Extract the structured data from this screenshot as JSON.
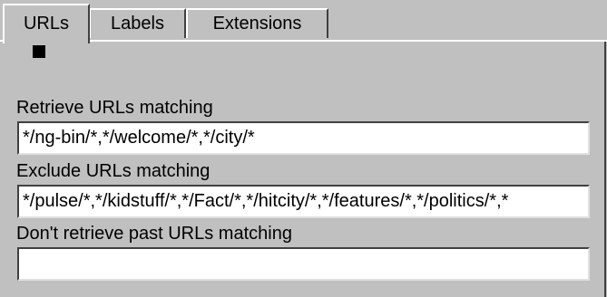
{
  "tabs": [
    {
      "label": "URLs",
      "active": true
    },
    {
      "label": "Labels",
      "active": false
    },
    {
      "label": "Extensions",
      "active": false
    }
  ],
  "fields": {
    "retrieve": {
      "label": "Retrieve URLs matching",
      "value": "*/ng-bin/*,*/welcome/*,*/city/*"
    },
    "exclude": {
      "label": "Exclude URLs matching",
      "value": "*/pulse/*,*/kidstuff/*,*/Fact/*,*/hitcity/*,*/features/*,*/politics/*,*"
    },
    "dont_retrieve_past": {
      "label": "Don't retrieve past URLs matching",
      "value": ""
    }
  },
  "colors": {
    "background": "#c0c0c0",
    "field_background": "#ffffff",
    "highlight": "#ffffff",
    "shadow": "#404040"
  }
}
